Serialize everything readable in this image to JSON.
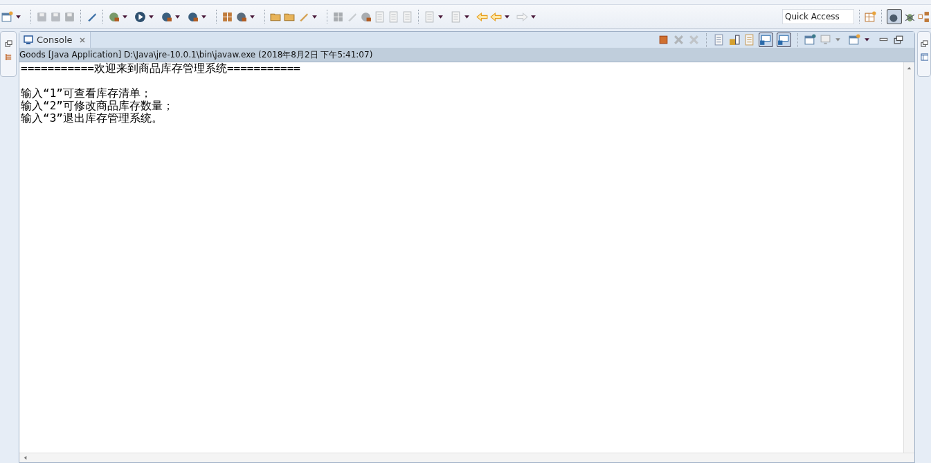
{
  "toolbar": {
    "quick_access": {
      "placeholder": "Quick Access"
    }
  },
  "console_view": {
    "tab": {
      "label": "Console",
      "selected": true
    },
    "toggles": [
      {
        "on": true
      },
      {
        "on": true
      }
    ],
    "process_label": "Goods [Java Application] D:\\Java\\jre-10.0.1\\bin\\javaw.exe (2018年8月2日 下午5:41:07)",
    "banner": "===========欢迎来到商品库存管理系统===========",
    "lines": [
      "输入“1”可查看库存清单；",
      "输入“2”可修改商品库存数量；",
      "输入“3”退出库存管理系统。"
    ]
  }
}
